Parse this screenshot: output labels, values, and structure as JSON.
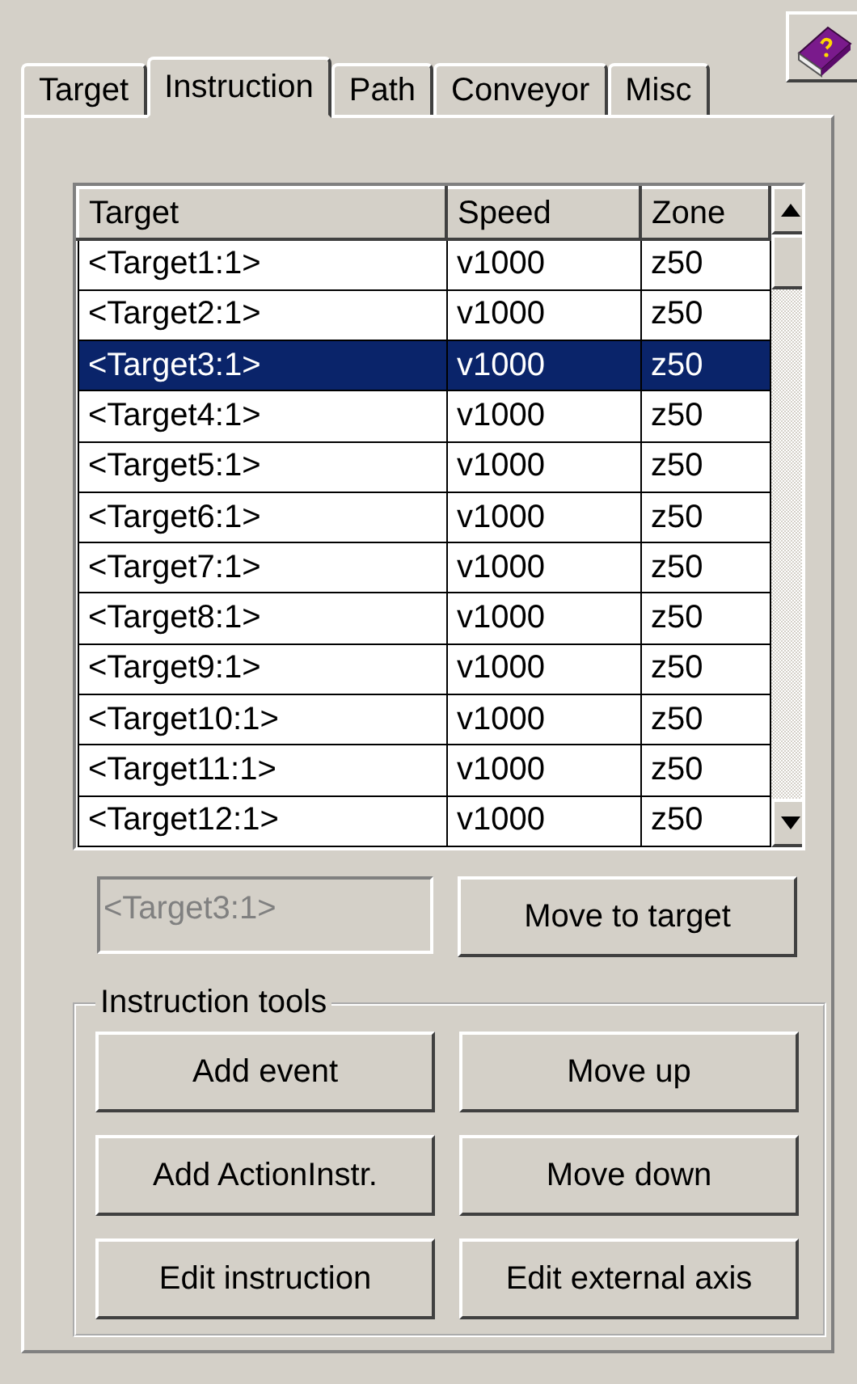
{
  "tabs": [
    {
      "label": "Target",
      "selected": false
    },
    {
      "label": "Instruction",
      "selected": true
    },
    {
      "label": "Path",
      "selected": false
    },
    {
      "label": "Conveyor",
      "selected": false
    },
    {
      "label": "Misc",
      "selected": false
    }
  ],
  "table": {
    "columns": [
      "Target",
      "Speed",
      "Zone"
    ],
    "rows": [
      {
        "cells": [
          "<Target1:1>",
          "v1000",
          "z50"
        ],
        "selected": false
      },
      {
        "cells": [
          "<Target2:1>",
          "v1000",
          "z50"
        ],
        "selected": false
      },
      {
        "cells": [
          "<Target3:1>",
          "v1000",
          "z50"
        ],
        "selected": true
      },
      {
        "cells": [
          "<Target4:1>",
          "v1000",
          "z50"
        ],
        "selected": false
      },
      {
        "cells": [
          "<Target5:1>",
          "v1000",
          "z50"
        ],
        "selected": false
      },
      {
        "cells": [
          "<Target6:1>",
          "v1000",
          "z50"
        ],
        "selected": false
      },
      {
        "cells": [
          "<Target7:1>",
          "v1000",
          "z50"
        ],
        "selected": false
      },
      {
        "cells": [
          "<Target8:1>",
          "v1000",
          "z50"
        ],
        "selected": false
      },
      {
        "cells": [
          "<Target9:1>",
          "v1000",
          "z50"
        ],
        "selected": false
      },
      {
        "cells": [
          "<Target10:1>",
          "v1000",
          "z50"
        ],
        "selected": false
      },
      {
        "cells": [
          "<Target11:1>",
          "v1000",
          "z50"
        ],
        "selected": false
      },
      {
        "cells": [
          "<Target12:1>",
          "v1000",
          "z50"
        ],
        "selected": false
      }
    ]
  },
  "target_field": {
    "value": "<Target3:1>",
    "disabled": true
  },
  "move_button": "Move to target",
  "instruction_tools": {
    "title": "Instruction tools",
    "buttons": [
      "Add event",
      "Move up",
      "Add ActionInstr.",
      "Move down",
      "Edit instruction",
      "Edit external axis"
    ]
  }
}
